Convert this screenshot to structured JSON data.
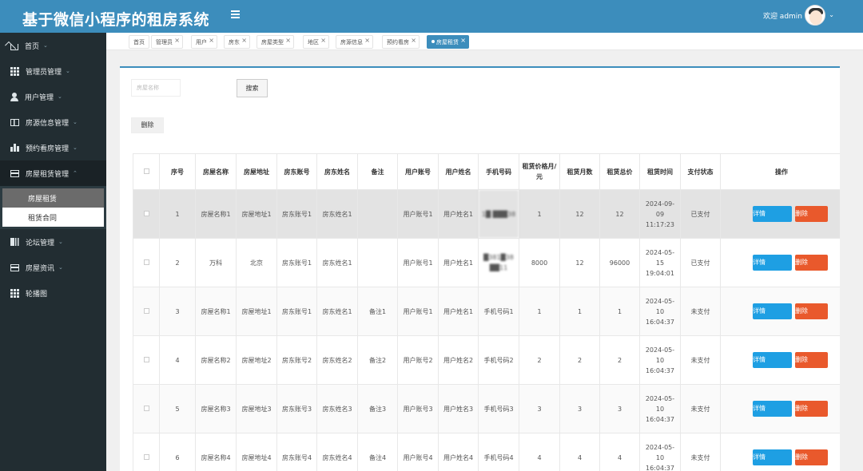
{
  "header": {
    "title": "基于微信小程序的租房系统",
    "welcome": "欢迎 admin",
    "icons": {
      "menu": "hamburger-icon",
      "avatar": "avatar-icon",
      "caret": "chevron-down-icon"
    }
  },
  "sidebar": {
    "items": [
      {
        "label": "首页",
        "icon": "home-icon"
      },
      {
        "label": "管理员管理",
        "icon": "grid-icon"
      },
      {
        "label": "用户管理",
        "icon": "user-icon"
      },
      {
        "label": "房源信息管理",
        "icon": "book-icon"
      },
      {
        "label": "预约看房管理",
        "icon": "building-icon"
      },
      {
        "label": "房屋租赁管理",
        "icon": "card-icon"
      },
      {
        "label": "论坛管理",
        "icon": "columns-icon"
      },
      {
        "label": "房屋资讯",
        "icon": "card-icon"
      },
      {
        "label": "轮播图",
        "icon": "grid-icon"
      }
    ],
    "submenu": [
      "房屋租赁",
      "租赁合同"
    ]
  },
  "tabs": [
    {
      "label": "首页"
    },
    {
      "label": "管理员"
    },
    {
      "label": "用户"
    },
    {
      "label": "房东"
    },
    {
      "label": "房屋类型"
    },
    {
      "label": "地区"
    },
    {
      "label": "房源信息"
    },
    {
      "label": "预约看房"
    },
    {
      "label": "房屋租赁"
    }
  ],
  "toolbar": {
    "search_placeholder": "房屋名称",
    "search_label": "搜索",
    "delete_label": "删除"
  },
  "table": {
    "headers": [
      "序号",
      "房屋名称",
      "房屋地址",
      "房东账号",
      "房东姓名",
      "备注",
      "用户账号",
      "用户姓名",
      "手机号码",
      "租赁价格月/元",
      "租赁月数",
      "租赁总价",
      "租赁时间",
      "支付状态",
      "操作"
    ],
    "detail_label": "详情",
    "delete_label": "删除",
    "rows": [
      {
        "no": "1",
        "house_name": "房屋名称1",
        "house_addr": "房屋地址1",
        "owner_acct": "房东账号1",
        "owner_name": "房东姓名1",
        "remark": "",
        "user_acct": "用户账号1",
        "user_name": "用户姓名1",
        "phone": "1█ ███38",
        "price": "1",
        "months": "12",
        "total": "12",
        "time": "2024-09-09 11:17:23",
        "pay": "已支付"
      },
      {
        "no": "2",
        "house_name": "万科",
        "house_addr": "北京",
        "owner_acct": "房东账号1",
        "owner_name": "房东姓名1",
        "remark": "",
        "user_acct": "用户账号1",
        "user_name": "用户姓名1",
        "phone": "█381█38 ██11",
        "price": "8000",
        "months": "12",
        "total": "96000",
        "time": "2024-05-15 19:04:01",
        "pay": "已支付"
      },
      {
        "no": "3",
        "house_name": "房屋名称1",
        "house_addr": "房屋地址1",
        "owner_acct": "房东账号1",
        "owner_name": "房东姓名1",
        "remark": "备注1",
        "user_acct": "用户账号1",
        "user_name": "用户姓名1",
        "phone": "手机号码1",
        "price": "1",
        "months": "1",
        "total": "1",
        "time": "2024-05-10 16:04:37",
        "pay": "未支付"
      },
      {
        "no": "4",
        "house_name": "房屋名称2",
        "house_addr": "房屋地址2",
        "owner_acct": "房东账号2",
        "owner_name": "房东姓名2",
        "remark": "备注2",
        "user_acct": "用户账号2",
        "user_name": "用户姓名2",
        "phone": "手机号码2",
        "price": "2",
        "months": "2",
        "total": "2",
        "time": "2024-05-10 16:04:37",
        "pay": "未支付"
      },
      {
        "no": "5",
        "house_name": "房屋名称3",
        "house_addr": "房屋地址3",
        "owner_acct": "房东账号3",
        "owner_name": "房东姓名3",
        "remark": "备注3",
        "user_acct": "用户账号3",
        "user_name": "用户姓名3",
        "phone": "手机号码3",
        "price": "3",
        "months": "3",
        "total": "3",
        "time": "2024-05-10 16:04:37",
        "pay": "未支付"
      },
      {
        "no": "6",
        "house_name": "房屋名称4",
        "house_addr": "房屋地址4",
        "owner_acct": "房东账号4",
        "owner_name": "房东姓名4",
        "remark": "备注4",
        "user_acct": "用户账号4",
        "user_name": "用户姓名4",
        "phone": "手机号码4",
        "price": "4",
        "months": "4",
        "total": "4",
        "time": "2024-05-10 16:04:37",
        "pay": "未支付"
      }
    ]
  },
  "colors": {
    "header": "#3c8dbc",
    "sidebar": "#222d32",
    "detail_button": "#1e9fe3",
    "delete_button": "#e9592c"
  }
}
